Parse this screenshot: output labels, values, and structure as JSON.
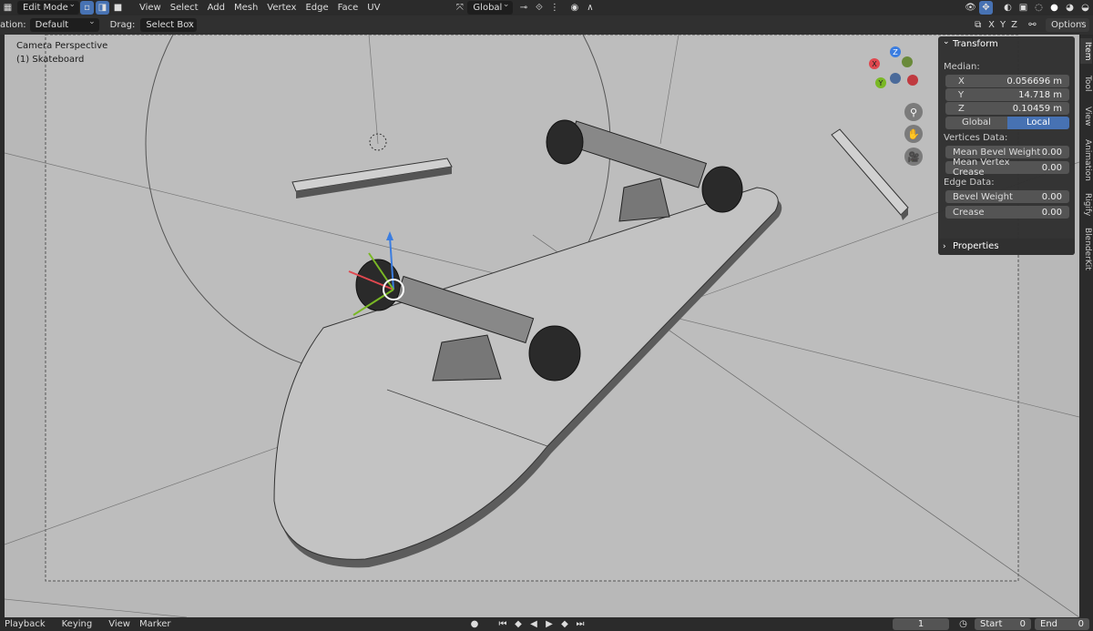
{
  "header": {
    "mode": "Edit Mode",
    "menus": [
      "View",
      "Select",
      "Add",
      "Mesh",
      "Vertex",
      "Edge",
      "Face",
      "UV"
    ],
    "orientation": "Global",
    "options_label": "Options",
    "axis_labels": [
      "X",
      "Y",
      "Z"
    ]
  },
  "toolbar": {
    "orientation_label": "ation:",
    "orientation_value": "Default",
    "drag_label": "Drag:",
    "drag_value": "Select Box"
  },
  "viewport": {
    "camera_label": "Camera Perspective",
    "object_label": "(1) Skateboard",
    "background_color": "#b8b8b8"
  },
  "navigation_gizmo": {
    "axes": [
      "X",
      "Y",
      "Z"
    ],
    "colors": {
      "x": "#e0484f",
      "y": "#7ab825",
      "z": "#3b7de0"
    }
  },
  "sidebar": {
    "tabs": [
      "Item",
      "Tool",
      "View",
      "Animation",
      "Rigify",
      "BlenderKit"
    ],
    "transform": {
      "title": "Transform",
      "median_label": "Median:",
      "x_label": "X",
      "x_value": "0.056696 m",
      "y_label": "Y",
      "y_value": "14.718 m",
      "z_label": "Z",
      "z_value": "0.10459 m",
      "space_global": "Global",
      "space_local": "Local",
      "vertices_data_label": "Vertices Data:",
      "mean_bevel_weight_label": "Mean Bevel Weight",
      "mean_bevel_weight_value": "0.00",
      "mean_vertex_crease_label": "Mean Vertex Crease",
      "mean_vertex_crease_value": "0.00",
      "edge_data_label": "Edge Data:",
      "bevel_weight_label": "Bevel Weight",
      "bevel_weight_value": "0.00",
      "crease_label": "Crease",
      "crease_value": "0.00"
    },
    "properties_title": "Properties"
  },
  "timeline": {
    "menus": [
      "Playback",
      "Keying",
      "View",
      "Marker"
    ],
    "current_frame": "1",
    "start_label": "Start",
    "start_value": "0",
    "end_label": "End",
    "end_value": "0"
  },
  "colors": {
    "accent": "#4772b3"
  }
}
